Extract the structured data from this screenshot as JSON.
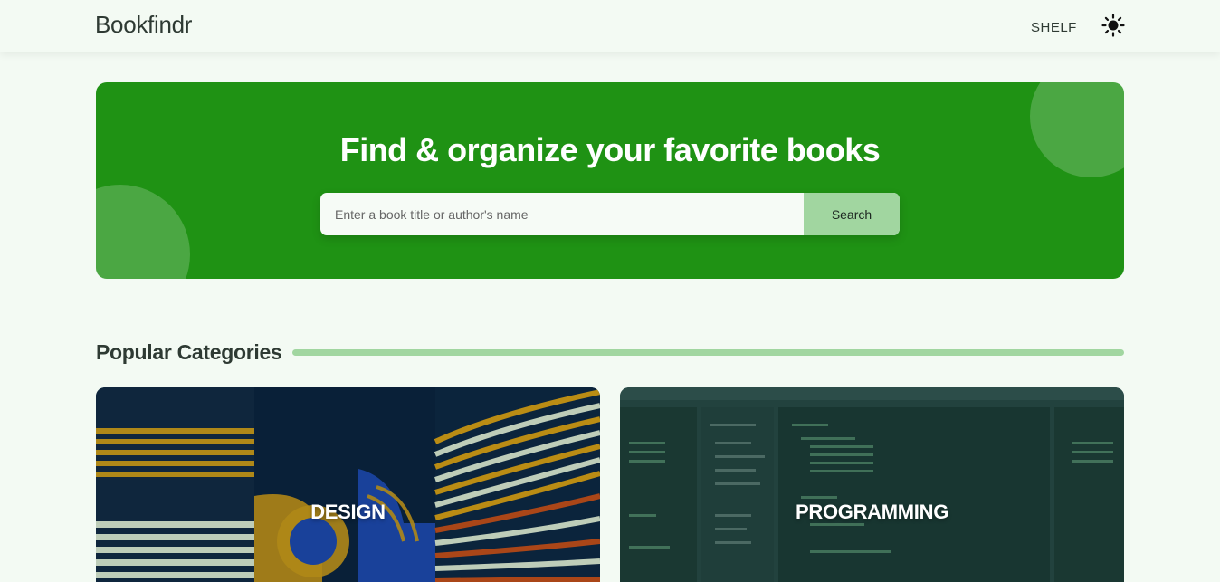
{
  "nav": {
    "logo": "Bookfindr",
    "shelf_label": "SHELF",
    "theme_icon": "sun-icon"
  },
  "hero": {
    "title": "Find & organize your favorite books",
    "search_placeholder": "Enter a book title or author's name",
    "search_button": "Search"
  },
  "categories": {
    "title": "Popular Categories",
    "items": [
      {
        "label": "DESIGN"
      },
      {
        "label": "PROGRAMMING"
      }
    ]
  },
  "colors": {
    "page_bg": "#f3faf3",
    "accent": "#1f9214",
    "accent_light": "#a1d6a0",
    "text": "#2e3a33"
  }
}
